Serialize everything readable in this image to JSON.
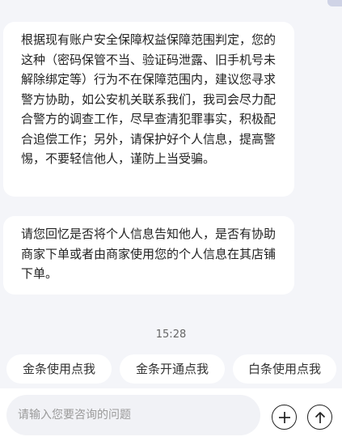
{
  "messages": [
    {
      "text": "根据现有账户安全保障权益保障范围判定，您的这种（密码保管不当、验证码泄露、旧手机号未解除绑定等）行为不在保障范围内，建议您寻求警方协助，如公安机关联系我们，我司会尽力配合警方的调查工作，尽早查清犯罪事实，积极配合追偿工作；另外，请保护好个人信息，提高警惕，不要轻信他人，谨防上当受骗。"
    },
    {
      "text": "请您回忆是否将个人信息告知他人，是否有协助商家下单或者由商家使用您的个人信息在其店铺下单。"
    }
  ],
  "timestamp": "15:28",
  "quick_replies": [
    "金条使用点我",
    "金条开通点我",
    "白条使用点我"
  ],
  "input": {
    "placeholder": "请输入您要咨询的问题"
  },
  "icons": {
    "add": "plus-circle-icon",
    "send": "arrow-up-circle-icon"
  }
}
